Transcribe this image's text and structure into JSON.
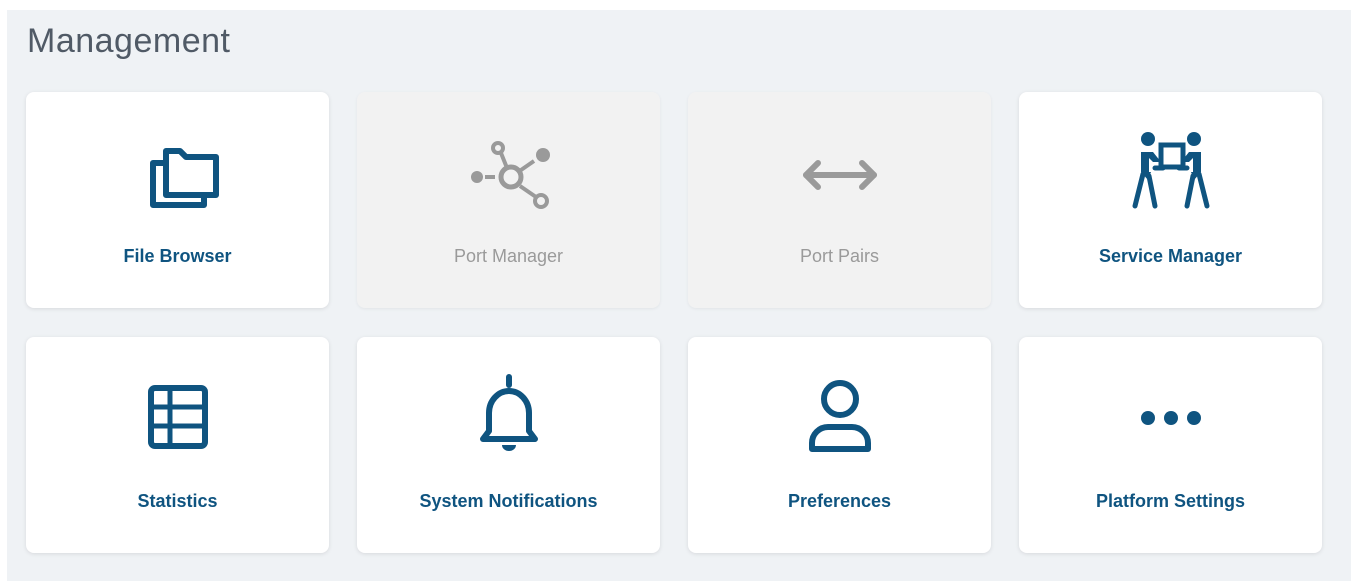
{
  "section": {
    "title": "Management"
  },
  "colors": {
    "accent": "#0f5480",
    "disabled": "#9a9a9a",
    "background": "#eff2f5"
  },
  "tiles": [
    {
      "label": "File Browser",
      "icon": "folders-icon",
      "enabled": true
    },
    {
      "label": "Port Manager",
      "icon": "network-nodes-icon",
      "enabled": false
    },
    {
      "label": "Port Pairs",
      "icon": "double-arrow-icon",
      "enabled": false
    },
    {
      "label": "Service Manager",
      "icon": "people-carrying-box-icon",
      "enabled": true
    },
    {
      "label": "Statistics",
      "icon": "table-icon",
      "enabled": true
    },
    {
      "label": "System Notifications",
      "icon": "bell-icon",
      "enabled": true
    },
    {
      "label": "Preferences",
      "icon": "user-icon",
      "enabled": true
    },
    {
      "label": "Platform Settings",
      "icon": "more-dots-icon",
      "enabled": true
    }
  ]
}
